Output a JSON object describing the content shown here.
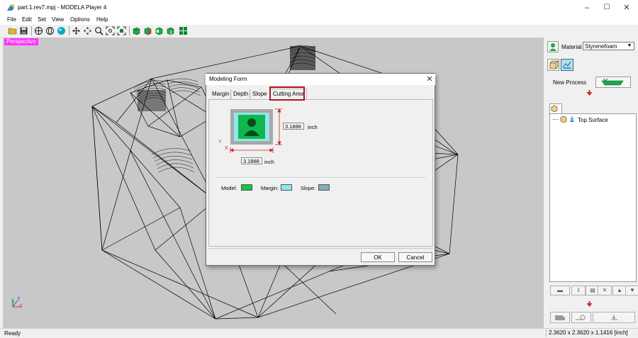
{
  "window": {
    "title": "part.1.rev7.mpj - MODELA Player 4",
    "minimize_glyph": "–",
    "maximize_glyph": "☐",
    "close_glyph": "✕"
  },
  "menu": {
    "items": [
      {
        "label": "File"
      },
      {
        "label": "Edit"
      },
      {
        "label": "Set"
      },
      {
        "label": "View"
      },
      {
        "label": "Options"
      },
      {
        "label": "Help"
      }
    ]
  },
  "viewport": {
    "mode_label": "Perspective",
    "axis_labels": {
      "x": "X",
      "y": "Y",
      "z": "Z"
    }
  },
  "right_panel": {
    "material_label": "Material",
    "material_value": "Styrenefoam",
    "new_process_label": "New Process",
    "tree_item_label": "Top Surface"
  },
  "status": {
    "text": "Ready",
    "dimensions": "2.3620 x 2.3620 x 1.1416 [inch]"
  },
  "dialog": {
    "title": "Modeling Form",
    "close_glyph": "✕",
    "tabs": [
      {
        "label": "Margin",
        "selected": false
      },
      {
        "label": "Depth",
        "selected": false
      },
      {
        "label": "Slope",
        "selected": false
      },
      {
        "label": "Cutting Area",
        "selected": true
      }
    ],
    "height_value": "3.1888",
    "width_value": "3.1888",
    "unit": "inch",
    "axis_x": "X",
    "axis_y": "Y",
    "legend": {
      "model_label": "Model:",
      "margin_label": "Margin:",
      "slope_label": "Slope:"
    },
    "ok_label": "OK",
    "cancel_label": "Cancel"
  },
  "colors": {
    "model": "#0fc846",
    "margin": "#8fe6ee",
    "slope": "#7fb0b4",
    "perspective_badge": "#ff33ff",
    "highlight": "#b01717"
  }
}
